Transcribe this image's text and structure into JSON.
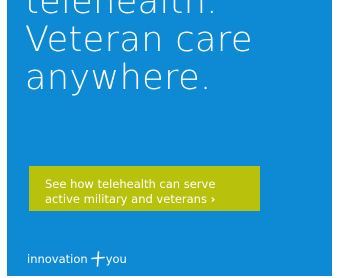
{
  "ad": {
    "background_color": "#0d8ad3",
    "headline": {
      "line1": "telehealth.",
      "line2": "Veteran care",
      "line3": "anywhere."
    },
    "cta": {
      "line1": "See how telehealth can serve",
      "line2": "active military and veterans",
      "chevron": "›",
      "color": "#b8c10b"
    },
    "brand": {
      "left_word": "innovation",
      "icon": "plus-icon",
      "right_word": "you"
    }
  }
}
